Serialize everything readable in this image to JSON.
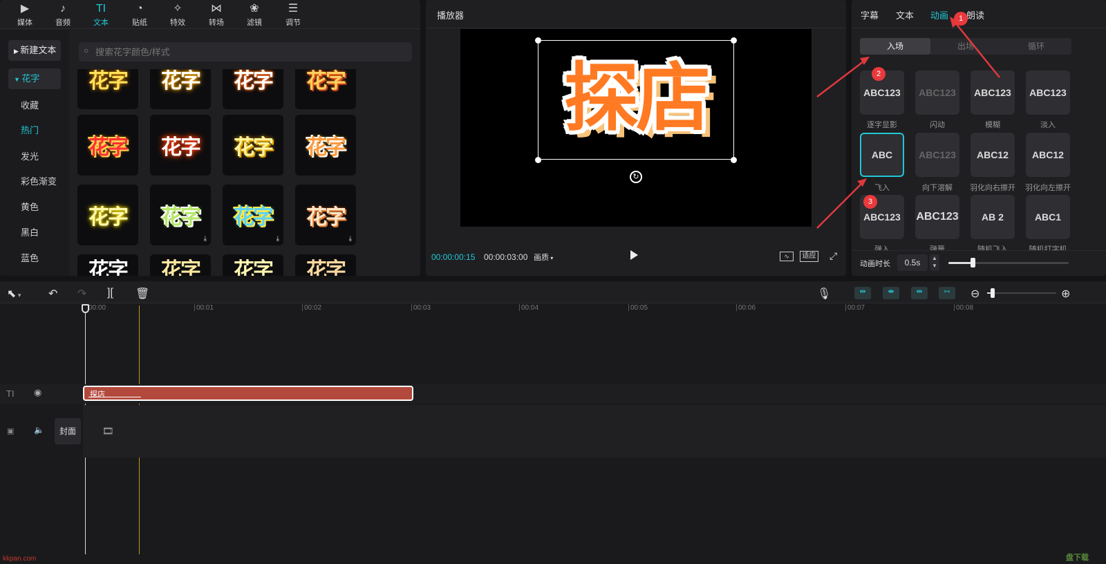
{
  "toolbar": {
    "items": [
      {
        "label": "媒体",
        "icon": "▶"
      },
      {
        "label": "音频",
        "icon": "♪"
      },
      {
        "label": "文本",
        "icon": "TI"
      },
      {
        "label": "贴纸",
        "icon": "◔"
      },
      {
        "label": "特效",
        "icon": "✧"
      },
      {
        "label": "转场",
        "icon": "⋈"
      },
      {
        "label": "滤镜",
        "icon": "❀"
      },
      {
        "label": "调节",
        "icon": "☰"
      }
    ]
  },
  "sidebar": {
    "new_text": "新建文本",
    "huazi": "花字",
    "items": [
      "收藏",
      "热门",
      "发光",
      "彩色渐变",
      "黄色",
      "黑白",
      "蓝色"
    ]
  },
  "search": {
    "placeholder": "搜索花字颜色/样式"
  },
  "tiles": {
    "text": "花字"
  },
  "player": {
    "title": "播放器",
    "caption": "探店",
    "current_time": "00:00:00:15",
    "total_time": "00:00:03:00",
    "quality": "画质",
    "fit": "适应"
  },
  "right": {
    "tabs": [
      "字幕",
      "文本",
      "动画",
      "朗读"
    ],
    "segments": [
      "入场",
      "出场",
      "循环"
    ],
    "animations": [
      {
        "preview": "ABC123",
        "label": "逐字显影"
      },
      {
        "preview": "ABC123",
        "label": "闪动"
      },
      {
        "preview": "ABC123",
        "label": "模糊"
      },
      {
        "preview": "ABC123",
        "label": "淡入"
      },
      {
        "preview": "ABC",
        "label": "飞入"
      },
      {
        "preview": "ABC123",
        "label": "向下溶解"
      },
      {
        "preview": "ABC12",
        "label": "羽化向右擦开"
      },
      {
        "preview": "ABC12",
        "label": "羽化向左擦开"
      },
      {
        "preview": "ABC123",
        "label": "弹入"
      },
      {
        "preview": "ABC123",
        "label": "弹簧"
      },
      {
        "preview": "AB 2",
        "label": "随机飞入"
      },
      {
        "preview": "ABC1",
        "label": "随机打字机"
      }
    ],
    "duration_label": "动画时长",
    "duration_value": "0.5s",
    "duration_fraction": 0.2
  },
  "timeline": {
    "ticks": [
      "00:00",
      "00:01",
      "00:02",
      "00:03",
      "00:04",
      "00:05",
      "00:06",
      "00:07",
      "00:08"
    ],
    "text_clip": "探店",
    "cover_label": "封面",
    "zoom_fraction": 0.08
  },
  "badges": [
    "1",
    "2",
    "3"
  ],
  "watermark_left": "kkpan.com",
  "watermark_right": "盘下载"
}
